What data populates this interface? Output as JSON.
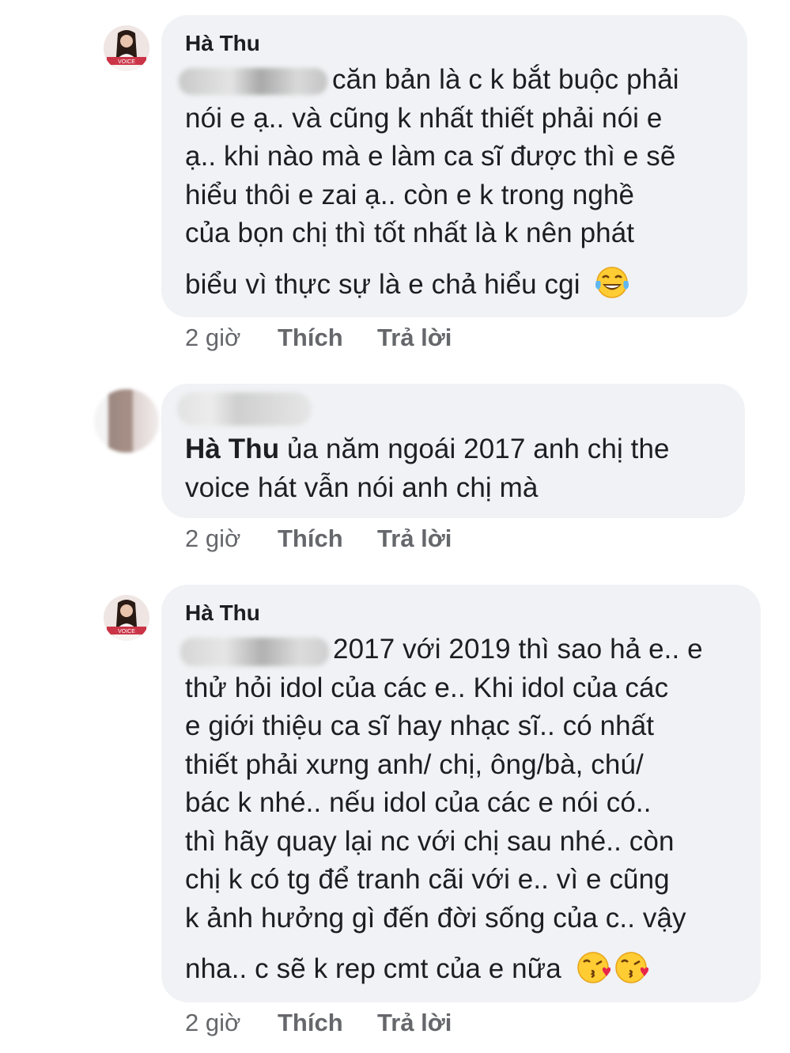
{
  "comments": [
    {
      "author": "Hà Thu",
      "lines": [
        "căn bản là c k bắt buộc phải",
        "nói e ạ.. và cũng k nhất thiết phải nói e",
        "ạ.. khi nào mà e làm ca sĩ được thì e sẽ",
        "hiểu thôi e zai ạ.. còn e k trong nghề",
        "của bọn chị thì tốt nhất là k nên phát",
        "biểu vì thực sự là e chả hiểu cgi"
      ],
      "time": "2 giờ",
      "like": "Thích",
      "reply": "Trả lời",
      "emoji": [
        "face-with-tears-of-joy-icon"
      ]
    },
    {
      "author": "",
      "mention": "Hà Thu",
      "lines": [
        "ủa năm ngoái 2017 anh chị the",
        "voice hát vẫn nói anh chị mà"
      ],
      "time": "2 giờ",
      "like": "Thích",
      "reply": "Trả lời"
    },
    {
      "author": "Hà Thu",
      "lines": [
        "2017 với 2019 thì sao hả e.. e",
        "thử hỏi idol của các e.. Khi idol của các",
        "e giới thiệu ca sĩ hay nhạc sĩ.. có nhất",
        "thiết phải xưng anh/ chị, ông/bà, chú/",
        "bác k nhé.. nếu idol của các e nói có..",
        "thì hãy quay lại nc với chị sau nhé.. còn",
        "chị k có tg để tranh cãi với e.. vì e cũng",
        "k ảnh hưởng gì đến đời sống của c.. vậy",
        "nha.. c sẽ k rep cmt của e nữa"
      ],
      "time": "2 giờ",
      "like": "Thích",
      "reply": "Trả lời",
      "emoji": [
        "kissing-heart-face-icon",
        "kissing-heart-face-icon"
      ]
    }
  ],
  "colors": {
    "bubble": "#f0f2f5",
    "text": "#1c1e21",
    "meta": "#65676b"
  }
}
